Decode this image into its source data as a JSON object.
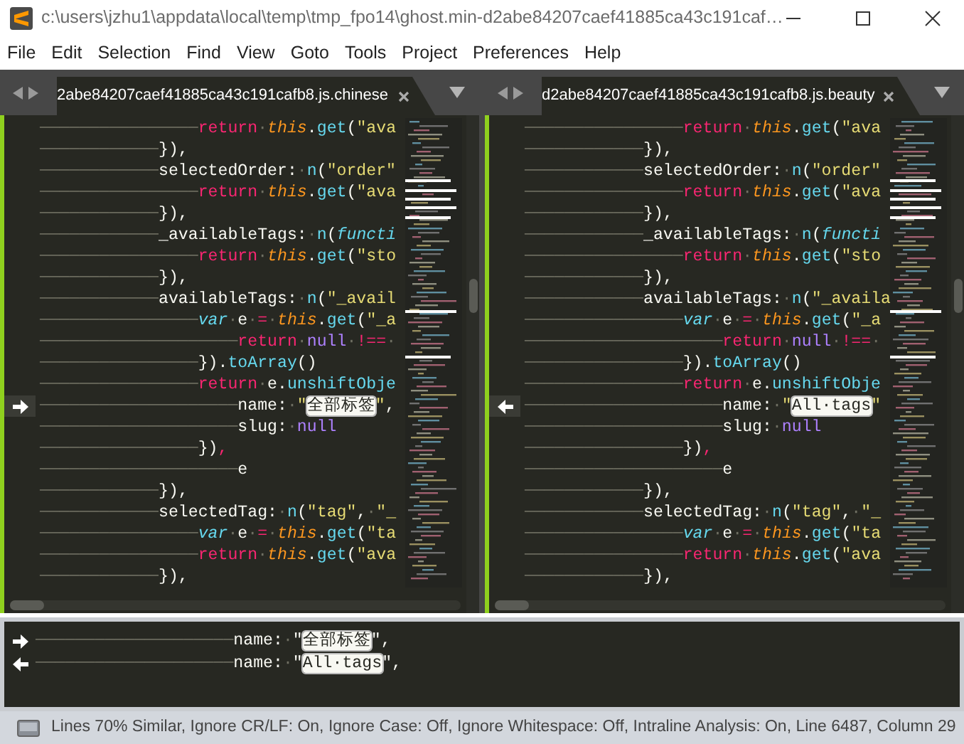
{
  "window": {
    "title": "c:\\users\\jzhu1\\appdata\\local\\temp\\tmp_fpo14\\ghost.min-d2abe84207caef41885ca43c191caf…"
  },
  "menu": [
    "File",
    "Edit",
    "Selection",
    "Find",
    "View",
    "Goto",
    "Tools",
    "Project",
    "Preferences",
    "Help"
  ],
  "panes": [
    {
      "tab": {
        "label": "2abe84207caef41885ca43c191cafb8.js.chinese",
        "selected": true
      },
      "arrow_right": true,
      "lines": [
        {
          "changed": false,
          "indent": "────────────────",
          "tokens": [
            {
              "kind": "kw",
              "text": "return"
            },
            {
              "kind": "ws",
              "text": "·"
            },
            {
              "kind": "self",
              "text": "this"
            },
            {
              "kind": "plain",
              "text": "."
            },
            {
              "kind": "fn",
              "text": "get"
            },
            {
              "kind": "plain",
              "text": "("
            },
            {
              "kind": "str",
              "text": "\"ava"
            }
          ]
        },
        {
          "changed": false,
          "indent": "────────────",
          "tokens": [
            {
              "kind": "plain",
              "text": "}),"
            }
          ]
        },
        {
          "changed": false,
          "indent": "────────────",
          "tokens": [
            {
              "kind": "plain",
              "text": "selectedOrder:"
            },
            {
              "kind": "ws",
              "text": "·"
            },
            {
              "kind": "fn",
              "text": "n"
            },
            {
              "kind": "plain",
              "text": "("
            },
            {
              "kind": "str",
              "text": "\"order\""
            }
          ]
        },
        {
          "changed": false,
          "indent": "────────────────",
          "tokens": [
            {
              "kind": "kw",
              "text": "return"
            },
            {
              "kind": "ws",
              "text": "·"
            },
            {
              "kind": "self",
              "text": "this"
            },
            {
              "kind": "plain",
              "text": "."
            },
            {
              "kind": "fn",
              "text": "get"
            },
            {
              "kind": "plain",
              "text": "("
            },
            {
              "kind": "str",
              "text": "\"ava"
            }
          ]
        },
        {
          "changed": false,
          "indent": "────────────",
          "tokens": [
            {
              "kind": "plain",
              "text": "}),"
            }
          ]
        },
        {
          "changed": false,
          "indent": "────────────",
          "tokens": [
            {
              "kind": "plain",
              "text": "_availableTags:"
            },
            {
              "kind": "ws",
              "text": "·"
            },
            {
              "kind": "fn",
              "text": "n"
            },
            {
              "kind": "plain",
              "text": "("
            },
            {
              "kind": "storage",
              "text": "functi"
            }
          ]
        },
        {
          "changed": false,
          "indent": "────────────────",
          "tokens": [
            {
              "kind": "kw",
              "text": "return"
            },
            {
              "kind": "ws",
              "text": "·"
            },
            {
              "kind": "self",
              "text": "this"
            },
            {
              "kind": "plain",
              "text": "."
            },
            {
              "kind": "fn",
              "text": "get"
            },
            {
              "kind": "plain",
              "text": "("
            },
            {
              "kind": "str",
              "text": "\"sto"
            }
          ]
        },
        {
          "changed": false,
          "indent": "────────────",
          "tokens": [
            {
              "kind": "plain",
              "text": "}),"
            }
          ]
        },
        {
          "changed": false,
          "indent": "────────────",
          "tokens": [
            {
              "kind": "plain",
              "text": "availableTags:"
            },
            {
              "kind": "ws",
              "text": "·"
            },
            {
              "kind": "fn",
              "text": "n"
            },
            {
              "kind": "plain",
              "text": "("
            },
            {
              "kind": "str",
              "text": "\"_avail"
            }
          ]
        },
        {
          "changed": false,
          "indent": "────────────────",
          "tokens": [
            {
              "kind": "storage",
              "text": "var"
            },
            {
              "kind": "ws",
              "text": "·"
            },
            {
              "kind": "plain",
              "text": "e"
            },
            {
              "kind": "ws",
              "text": "·"
            },
            {
              "kind": "op",
              "text": "="
            },
            {
              "kind": "ws",
              "text": "·"
            },
            {
              "kind": "self",
              "text": "this"
            },
            {
              "kind": "plain",
              "text": "."
            },
            {
              "kind": "fn",
              "text": "get"
            },
            {
              "kind": "plain",
              "text": "("
            },
            {
              "kind": "str",
              "text": "\"_a"
            }
          ]
        },
        {
          "changed": false,
          "indent": "────────────────────",
          "tokens": [
            {
              "kind": "kw",
              "text": "return"
            },
            {
              "kind": "ws",
              "text": "·"
            },
            {
              "kind": "const",
              "text": "null"
            },
            {
              "kind": "ws",
              "text": "·"
            },
            {
              "kind": "op",
              "text": "!=="
            },
            {
              "kind": "ws",
              "text": "·"
            }
          ]
        },
        {
          "changed": false,
          "indent": "────────────────",
          "tokens": [
            {
              "kind": "plain",
              "text": "})."
            },
            {
              "kind": "fn",
              "text": "toArray"
            },
            {
              "kind": "plain",
              "text": "()"
            }
          ]
        },
        {
          "changed": false,
          "indent": "────────────────",
          "tokens": [
            {
              "kind": "kw",
              "text": "return"
            },
            {
              "kind": "ws",
              "text": "·"
            },
            {
              "kind": "plain",
              "text": "e."
            },
            {
              "kind": "fn",
              "text": "unshiftObje"
            }
          ]
        },
        {
          "changed": true,
          "indent": "────────────────────",
          "tokens": [
            {
              "kind": "plain",
              "text": "name:"
            },
            {
              "kind": "ws",
              "text": "·"
            },
            {
              "kind": "str",
              "text": "\""
            },
            {
              "kind": "hl",
              "text": "全部标签"
            },
            {
              "kind": "str",
              "text": "\""
            },
            {
              "kind": "plain",
              "text": ","
            }
          ]
        },
        {
          "changed": false,
          "indent": "────────────────────",
          "tokens": [
            {
              "kind": "plain",
              "text": "slug:"
            },
            {
              "kind": "ws",
              "text": "·"
            },
            {
              "kind": "const",
              "text": "null"
            }
          ]
        },
        {
          "changed": false,
          "indent": "────────────────",
          "tokens": [
            {
              "kind": "plain",
              "text": "})"
            },
            {
              "kind": "kw",
              "text": ","
            }
          ]
        },
        {
          "changed": false,
          "indent": "────────────────────",
          "tokens": [
            {
              "kind": "plain",
              "text": "e"
            }
          ]
        },
        {
          "changed": false,
          "indent": "────────────",
          "tokens": [
            {
              "kind": "plain",
              "text": "}),"
            }
          ]
        },
        {
          "changed": false,
          "indent": "────────────",
          "tokens": [
            {
              "kind": "plain",
              "text": "selectedTag:"
            },
            {
              "kind": "ws",
              "text": "·"
            },
            {
              "kind": "fn",
              "text": "n"
            },
            {
              "kind": "plain",
              "text": "("
            },
            {
              "kind": "str",
              "text": "\"tag\""
            },
            {
              "kind": "plain",
              "text": ","
            },
            {
              "kind": "ws",
              "text": "·"
            },
            {
              "kind": "str",
              "text": "\"_"
            }
          ]
        },
        {
          "changed": false,
          "indent": "────────────────",
          "tokens": [
            {
              "kind": "storage",
              "text": "var"
            },
            {
              "kind": "ws",
              "text": "·"
            },
            {
              "kind": "plain",
              "text": "e"
            },
            {
              "kind": "ws",
              "text": "·"
            },
            {
              "kind": "op",
              "text": "="
            },
            {
              "kind": "ws",
              "text": "·"
            },
            {
              "kind": "self",
              "text": "this"
            },
            {
              "kind": "plain",
              "text": "."
            },
            {
              "kind": "fn",
              "text": "get"
            },
            {
              "kind": "plain",
              "text": "("
            },
            {
              "kind": "str",
              "text": "\"ta"
            }
          ]
        },
        {
          "changed": false,
          "indent": "────────────────",
          "tokens": [
            {
              "kind": "kw",
              "text": "return"
            },
            {
              "kind": "ws",
              "text": "·"
            },
            {
              "kind": "self",
              "text": "this"
            },
            {
              "kind": "plain",
              "text": "."
            },
            {
              "kind": "fn",
              "text": "get"
            },
            {
              "kind": "plain",
              "text": "("
            },
            {
              "kind": "str",
              "text": "\"ava"
            }
          ]
        },
        {
          "changed": false,
          "indent": "────────────",
          "tokens": [
            {
              "kind": "plain",
              "text": "}),"
            }
          ]
        }
      ]
    },
    {
      "tab": {
        "label": "d2abe84207caef41885ca43c191cafb8.js.beauty",
        "selected": true
      },
      "arrow_right": false,
      "lines": [
        {
          "changed": false,
          "indent": "────────────────",
          "tokens": [
            {
              "kind": "kw",
              "text": "return"
            },
            {
              "kind": "ws",
              "text": "·"
            },
            {
              "kind": "self",
              "text": "this"
            },
            {
              "kind": "plain",
              "text": "."
            },
            {
              "kind": "fn",
              "text": "get"
            },
            {
              "kind": "plain",
              "text": "("
            },
            {
              "kind": "str",
              "text": "\"ava"
            }
          ]
        },
        {
          "changed": false,
          "indent": "────────────",
          "tokens": [
            {
              "kind": "plain",
              "text": "}),"
            }
          ]
        },
        {
          "changed": false,
          "indent": "────────────",
          "tokens": [
            {
              "kind": "plain",
              "text": "selectedOrder:"
            },
            {
              "kind": "ws",
              "text": "·"
            },
            {
              "kind": "fn",
              "text": "n"
            },
            {
              "kind": "plain",
              "text": "("
            },
            {
              "kind": "str",
              "text": "\"order\""
            }
          ]
        },
        {
          "changed": false,
          "indent": "────────────────",
          "tokens": [
            {
              "kind": "kw",
              "text": "return"
            },
            {
              "kind": "ws",
              "text": "·"
            },
            {
              "kind": "self",
              "text": "this"
            },
            {
              "kind": "plain",
              "text": "."
            },
            {
              "kind": "fn",
              "text": "get"
            },
            {
              "kind": "plain",
              "text": "("
            },
            {
              "kind": "str",
              "text": "\"ava"
            }
          ]
        },
        {
          "changed": false,
          "indent": "────────────",
          "tokens": [
            {
              "kind": "plain",
              "text": "}),"
            }
          ]
        },
        {
          "changed": false,
          "indent": "────────────",
          "tokens": [
            {
              "kind": "plain",
              "text": "_availableTags:"
            },
            {
              "kind": "ws",
              "text": "·"
            },
            {
              "kind": "fn",
              "text": "n"
            },
            {
              "kind": "plain",
              "text": "("
            },
            {
              "kind": "storage",
              "text": "functi"
            }
          ]
        },
        {
          "changed": false,
          "indent": "────────────────",
          "tokens": [
            {
              "kind": "kw",
              "text": "return"
            },
            {
              "kind": "ws",
              "text": "·"
            },
            {
              "kind": "self",
              "text": "this"
            },
            {
              "kind": "plain",
              "text": "."
            },
            {
              "kind": "fn",
              "text": "get"
            },
            {
              "kind": "plain",
              "text": "("
            },
            {
              "kind": "str",
              "text": "\"sto"
            }
          ]
        },
        {
          "changed": false,
          "indent": "────────────",
          "tokens": [
            {
              "kind": "plain",
              "text": "}),"
            }
          ]
        },
        {
          "changed": false,
          "indent": "────────────",
          "tokens": [
            {
              "kind": "plain",
              "text": "availableTags:"
            },
            {
              "kind": "ws",
              "text": "·"
            },
            {
              "kind": "fn",
              "text": "n"
            },
            {
              "kind": "plain",
              "text": "("
            },
            {
              "kind": "str",
              "text": "\"_availa"
            }
          ]
        },
        {
          "changed": false,
          "indent": "────────────────",
          "tokens": [
            {
              "kind": "storage",
              "text": "var"
            },
            {
              "kind": "ws",
              "text": "·"
            },
            {
              "kind": "plain",
              "text": "e"
            },
            {
              "kind": "ws",
              "text": "·"
            },
            {
              "kind": "op",
              "text": "="
            },
            {
              "kind": "ws",
              "text": "·"
            },
            {
              "kind": "self",
              "text": "this"
            },
            {
              "kind": "plain",
              "text": "."
            },
            {
              "kind": "fn",
              "text": "get"
            },
            {
              "kind": "plain",
              "text": "("
            },
            {
              "kind": "str",
              "text": "\"_a"
            }
          ]
        },
        {
          "changed": false,
          "indent": "────────────────────",
          "tokens": [
            {
              "kind": "kw",
              "text": "return"
            },
            {
              "kind": "ws",
              "text": "·"
            },
            {
              "kind": "const",
              "text": "null"
            },
            {
              "kind": "ws",
              "text": "·"
            },
            {
              "kind": "op",
              "text": "!=="
            },
            {
              "kind": "ws",
              "text": "·"
            }
          ]
        },
        {
          "changed": false,
          "indent": "────────────────",
          "tokens": [
            {
              "kind": "plain",
              "text": "})."
            },
            {
              "kind": "fn",
              "text": "toArray"
            },
            {
              "kind": "plain",
              "text": "()"
            }
          ]
        },
        {
          "changed": false,
          "indent": "────────────────",
          "tokens": [
            {
              "kind": "kw",
              "text": "return"
            },
            {
              "kind": "ws",
              "text": "·"
            },
            {
              "kind": "plain",
              "text": "e."
            },
            {
              "kind": "fn",
              "text": "unshiftObje"
            }
          ]
        },
        {
          "changed": true,
          "indent": "────────────────────",
          "tokens": [
            {
              "kind": "plain",
              "text": "name:"
            },
            {
              "kind": "ws",
              "text": "·"
            },
            {
              "kind": "str",
              "text": "\""
            },
            {
              "kind": "hl",
              "text": "All·tags"
            },
            {
              "kind": "str",
              "text": "\""
            }
          ]
        },
        {
          "changed": false,
          "indent": "────────────────────",
          "tokens": [
            {
              "kind": "plain",
              "text": "slug:"
            },
            {
              "kind": "ws",
              "text": "·"
            },
            {
              "kind": "const",
              "text": "null"
            }
          ]
        },
        {
          "changed": false,
          "indent": "────────────────",
          "tokens": [
            {
              "kind": "plain",
              "text": "})"
            },
            {
              "kind": "kw",
              "text": ","
            }
          ]
        },
        {
          "changed": false,
          "indent": "────────────────────",
          "tokens": [
            {
              "kind": "plain",
              "text": "e"
            }
          ]
        },
        {
          "changed": false,
          "indent": "────────────",
          "tokens": [
            {
              "kind": "plain",
              "text": "}),"
            }
          ]
        },
        {
          "changed": false,
          "indent": "────────────",
          "tokens": [
            {
              "kind": "plain",
              "text": "selectedTag:"
            },
            {
              "kind": "ws",
              "text": "·"
            },
            {
              "kind": "fn",
              "text": "n"
            },
            {
              "kind": "plain",
              "text": "("
            },
            {
              "kind": "str",
              "text": "\"tag\""
            },
            {
              "kind": "plain",
              "text": ","
            },
            {
              "kind": "ws",
              "text": "·"
            },
            {
              "kind": "str",
              "text": "\"_"
            }
          ]
        },
        {
          "changed": false,
          "indent": "────────────────",
          "tokens": [
            {
              "kind": "storage",
              "text": "var"
            },
            {
              "kind": "ws",
              "text": "·"
            },
            {
              "kind": "plain",
              "text": "e"
            },
            {
              "kind": "ws",
              "text": "·"
            },
            {
              "kind": "op",
              "text": "="
            },
            {
              "kind": "ws",
              "text": "·"
            },
            {
              "kind": "self",
              "text": "this"
            },
            {
              "kind": "plain",
              "text": "."
            },
            {
              "kind": "fn",
              "text": "get"
            },
            {
              "kind": "plain",
              "text": "("
            },
            {
              "kind": "str",
              "text": "\"ta"
            }
          ]
        },
        {
          "changed": false,
          "indent": "────────────────",
          "tokens": [
            {
              "kind": "kw",
              "text": "return"
            },
            {
              "kind": "ws",
              "text": "·"
            },
            {
              "kind": "self",
              "text": "this"
            },
            {
              "kind": "plain",
              "text": "."
            },
            {
              "kind": "fn",
              "text": "get"
            },
            {
              "kind": "plain",
              "text": "("
            },
            {
              "kind": "str",
              "text": "\"ava"
            }
          ]
        },
        {
          "changed": false,
          "indent": "────────────",
          "tokens": [
            {
              "kind": "plain",
              "text": "}),"
            }
          ]
        }
      ]
    }
  ],
  "diff_panel": {
    "lines": [
      {
        "arrow_right": true,
        "indent": "────────────────────",
        "tokens": [
          {
            "kind": "plain",
            "text": "name:"
          },
          {
            "kind": "ws",
            "text": "·"
          },
          {
            "kind": "plain",
            "text": "\""
          },
          {
            "kind": "hl",
            "text": "全部标签"
          },
          {
            "kind": "plain",
            "text": "\","
          }
        ]
      },
      {
        "arrow_right": false,
        "indent": "────────────────────",
        "tokens": [
          {
            "kind": "plain",
            "text": "name:"
          },
          {
            "kind": "ws",
            "text": "·"
          },
          {
            "kind": "plain",
            "text": "\""
          },
          {
            "kind": "hl",
            "text": "All·tags"
          },
          {
            "kind": "plain",
            "text": "\","
          }
        ]
      }
    ]
  },
  "status_bar": "Lines 70% Similar, Ignore CR/LF: On, Ignore Case: Off, Ignore Whitespace: Off, Intraline Analysis: On, Line 6487, Column 29"
}
